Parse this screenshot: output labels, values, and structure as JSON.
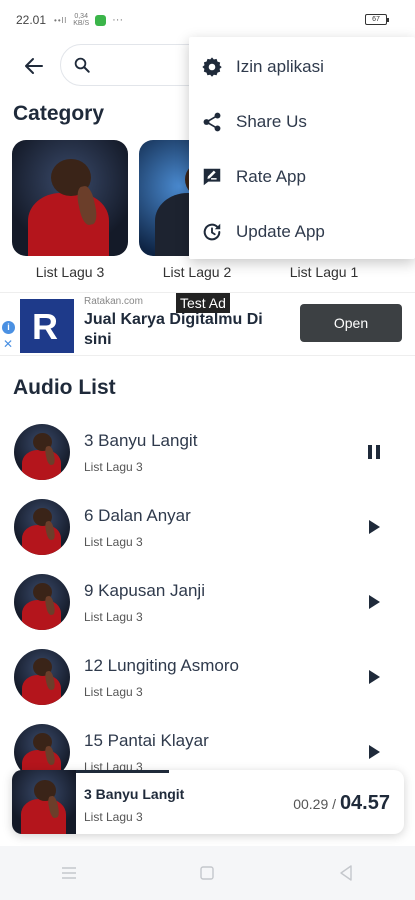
{
  "status_bar": {
    "time": "22.01",
    "network": "••ll",
    "speed_value": "0,34",
    "speed_unit": "KB/S",
    "more": "···",
    "battery": "67"
  },
  "search": {
    "placeholder": ""
  },
  "category": {
    "title": "Category",
    "items": [
      {
        "label": "List Lagu 3"
      },
      {
        "label": "List Lagu 2"
      },
      {
        "label": "List Lagu 1"
      }
    ]
  },
  "ad": {
    "tag": "Test Ad",
    "info": "i",
    "close": "✕",
    "domain": "Ratakan.com",
    "headline": "Jual Karya Digitalmu Di sini",
    "cta": "Open",
    "logo_letter": "R"
  },
  "audio": {
    "title": "Audio List",
    "items": [
      {
        "title": "3 Banyu Langit",
        "subtitle": "List Lagu 3",
        "state": "playing"
      },
      {
        "title": "6 Dalan Anyar",
        "subtitle": "List Lagu 3",
        "state": "paused"
      },
      {
        "title": "9 Kapusan Janji",
        "subtitle": "List Lagu 3",
        "state": "paused"
      },
      {
        "title": "12 Lungiting Asmoro",
        "subtitle": "List Lagu 3",
        "state": "paused"
      },
      {
        "title": "15 Pantai Klayar",
        "subtitle": "List Lagu 3",
        "state": "paused"
      }
    ]
  },
  "player": {
    "title": "3 Banyu Langit",
    "subtitle": "List Lagu 3",
    "elapsed": "00.29",
    "separator": " / ",
    "total": "04.57",
    "progress": 0.4
  },
  "menu": {
    "items": [
      {
        "label": "Izin aplikasi",
        "icon": "gear-icon"
      },
      {
        "label": "Share Us",
        "icon": "share-icon"
      },
      {
        "label": "Rate App",
        "icon": "rate-icon"
      },
      {
        "label": "Update App",
        "icon": "update-icon"
      }
    ]
  },
  "colors": {
    "accent": "#1f2a3a",
    "ad_button": "#3c4043",
    "ad_logo": "#1e3a8a"
  }
}
